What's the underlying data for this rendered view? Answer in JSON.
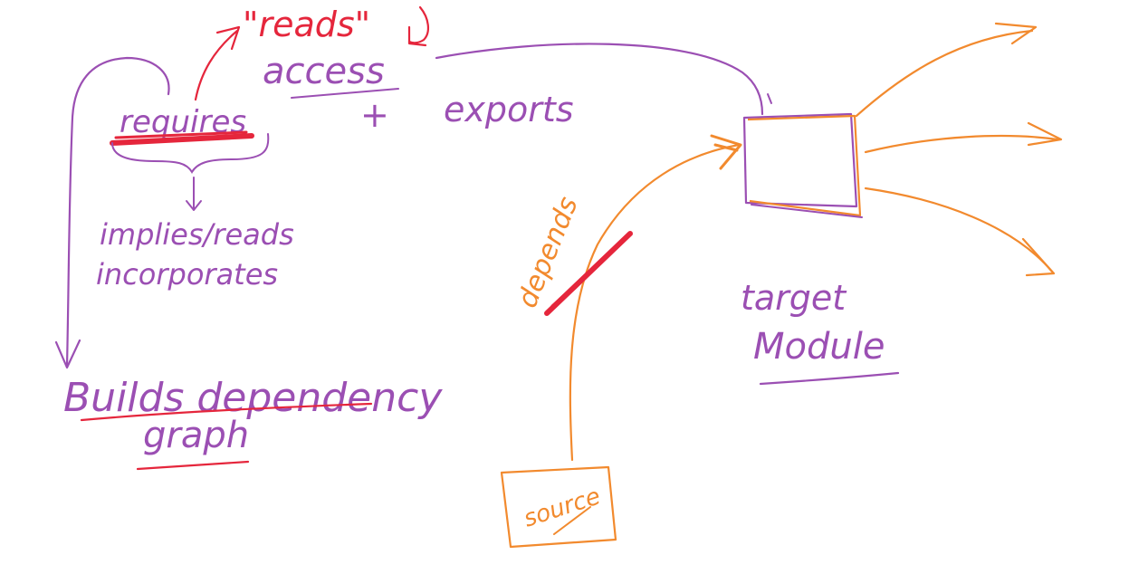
{
  "colors": {
    "purple": "#9b4fb3",
    "red": "#e5263c",
    "orange": "#f28a2e",
    "background": "#ffffff"
  },
  "notes": {
    "reads_quote": "\"reads\"",
    "access": "access",
    "plus": "+",
    "exports": "exports",
    "requires": "requires",
    "implies_reads": "implies/reads",
    "incorporates": "incorporates",
    "builds_dependency": "Builds dependency",
    "graph": "graph",
    "depends": "depends",
    "target": "target",
    "module": "Module",
    "source": "source"
  }
}
